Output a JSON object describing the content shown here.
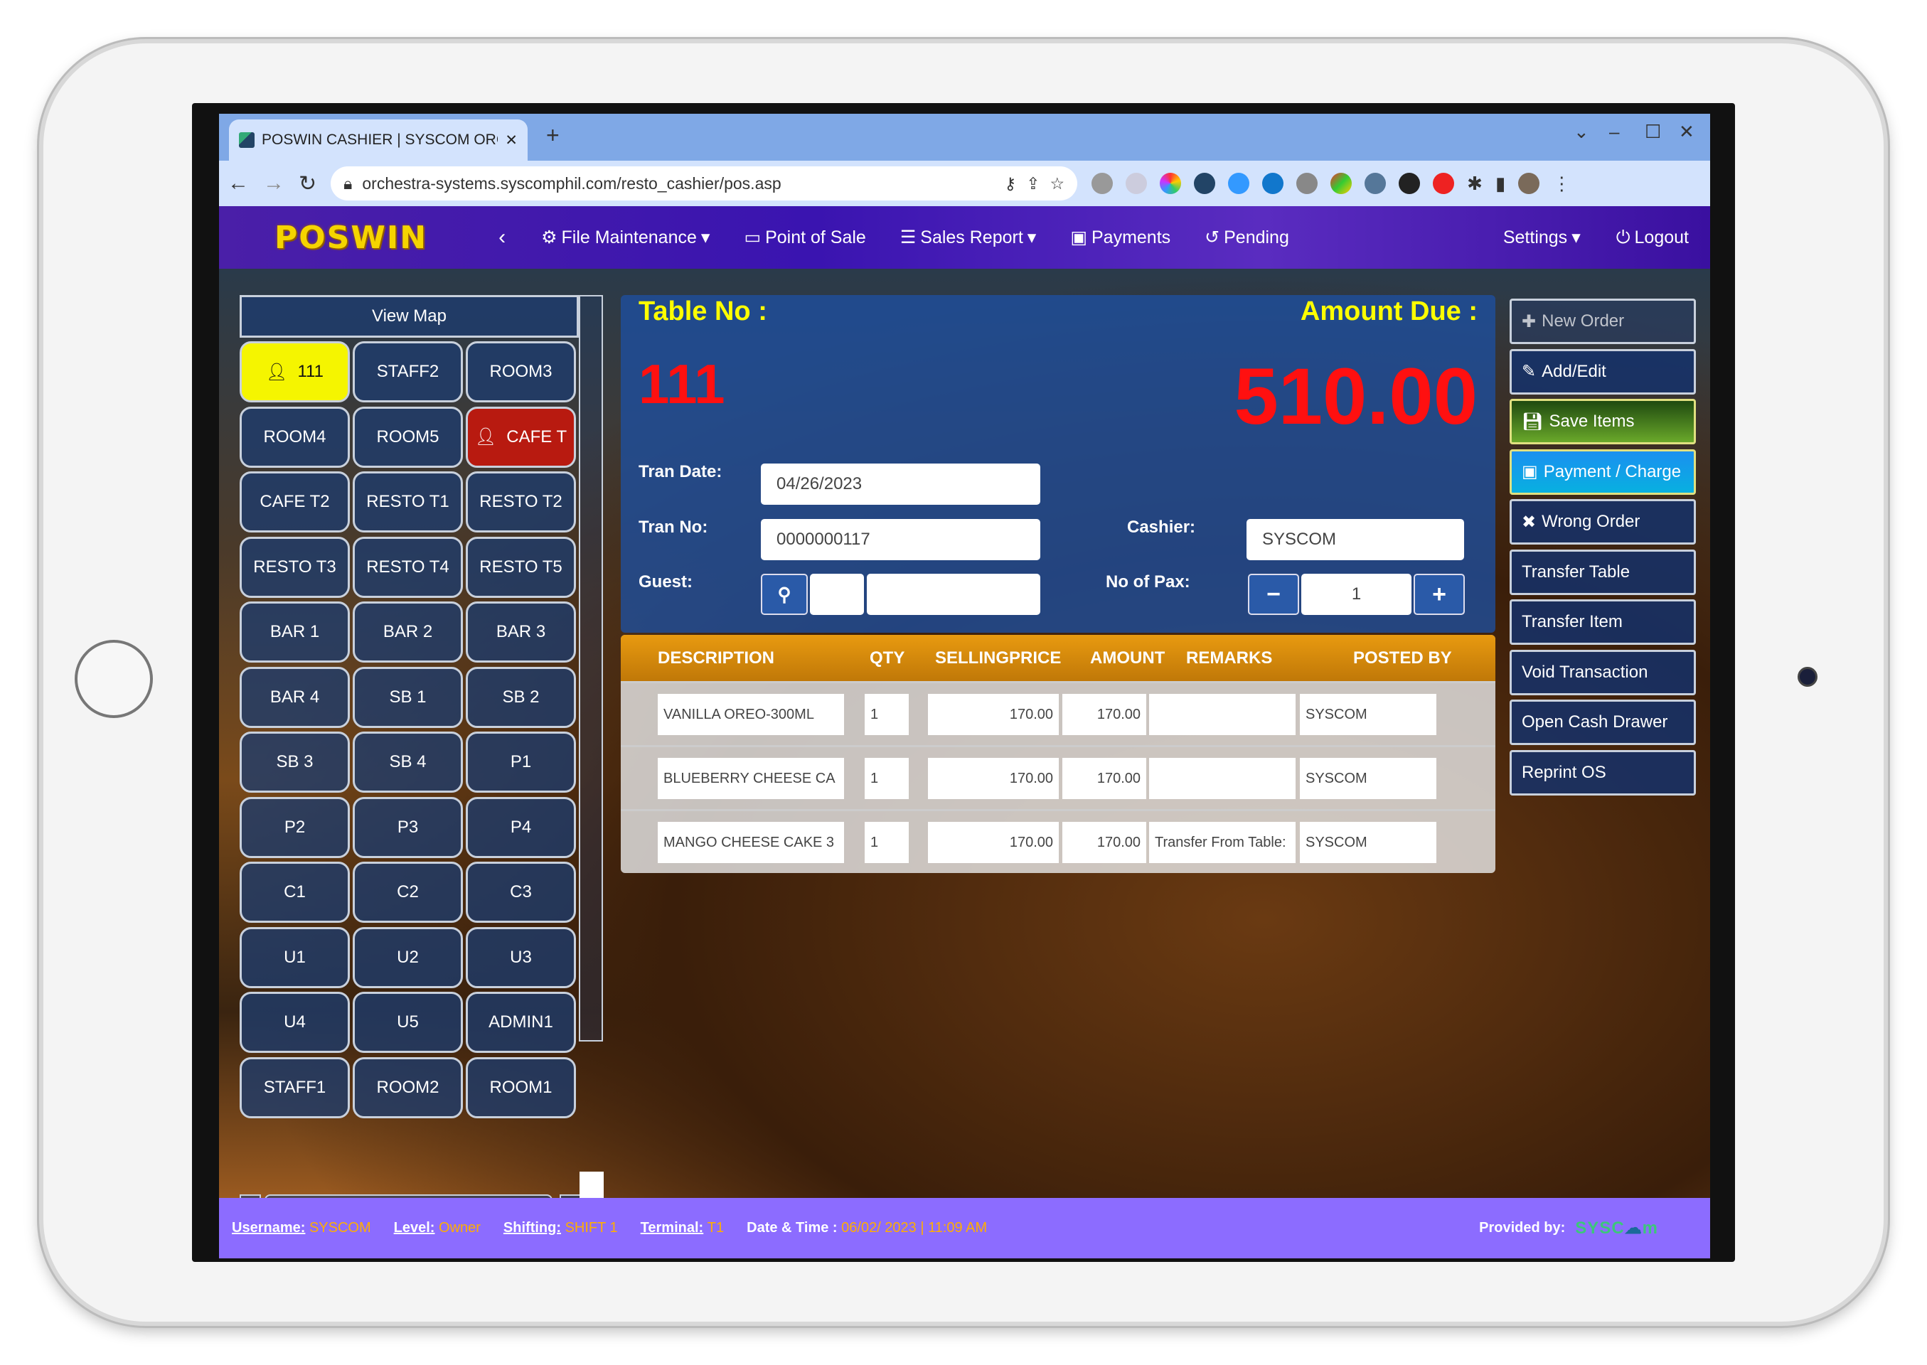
{
  "browser": {
    "tab_title": "POSWIN CASHIER | SYSCOM ORC",
    "url": "orchestra-systems.syscomphil.com/resto_cashier/pos.asp"
  },
  "nav": {
    "logo": "POSWIN",
    "items": [
      {
        "label": "File Maintenance",
        "icon": "gear-icon",
        "dropdown": true
      },
      {
        "label": "Point of Sale",
        "icon": "monitor-icon",
        "dropdown": false
      },
      {
        "label": "Sales Report",
        "icon": "list-icon",
        "dropdown": true
      },
      {
        "label": "Payments",
        "icon": "money-icon",
        "dropdown": false
      },
      {
        "label": "Pending",
        "icon": "history-icon",
        "dropdown": false
      }
    ],
    "settings": "Settings",
    "logout": "Logout"
  },
  "tables": {
    "view_map": "View Map",
    "items": [
      {
        "label": "111",
        "state": "selected"
      },
      {
        "label": "STAFF2"
      },
      {
        "label": "ROOM3"
      },
      {
        "label": "ROOM4"
      },
      {
        "label": "ROOM5"
      },
      {
        "label": "CAFE T",
        "state": "occupied"
      },
      {
        "label": "CAFE T2"
      },
      {
        "label": "RESTO T1"
      },
      {
        "label": "RESTO T2"
      },
      {
        "label": "RESTO T3"
      },
      {
        "label": "RESTO T4"
      },
      {
        "label": "RESTO T5"
      },
      {
        "label": "BAR 1"
      },
      {
        "label": "BAR 2"
      },
      {
        "label": "BAR 3"
      },
      {
        "label": "BAR 4"
      },
      {
        "label": "SB 1"
      },
      {
        "label": "SB 2"
      },
      {
        "label": "SB 3"
      },
      {
        "label": "SB 4"
      },
      {
        "label": "P1"
      },
      {
        "label": "P2"
      },
      {
        "label": "P3"
      },
      {
        "label": "P4"
      },
      {
        "label": "C1"
      },
      {
        "label": "C2"
      },
      {
        "label": "C3"
      },
      {
        "label": "U1"
      },
      {
        "label": "U2"
      },
      {
        "label": "U3"
      },
      {
        "label": "U4"
      },
      {
        "label": "U5"
      },
      {
        "label": "ADMIN1"
      },
      {
        "label": "STAFF1"
      },
      {
        "label": "ROOM2"
      },
      {
        "label": "ROOM1"
      }
    ]
  },
  "order": {
    "table_no_label": "Table No :",
    "table_no": "111",
    "amount_due_label": "Amount Due :",
    "amount_due": "510.00",
    "tran_date_label": "Tran Date:",
    "tran_date": "04/26/2023",
    "tran_no_label": "Tran No:",
    "tran_no": "0000000117",
    "cashier_label": "Cashier:",
    "cashier": "SYSCOM",
    "guest_label": "Guest:",
    "guest_code": "",
    "guest_name": "",
    "pax_label": "No of  Pax:",
    "pax": "1",
    "minus": "−",
    "plus": "+"
  },
  "items_table": {
    "columns": [
      "DESCRIPTION",
      "QTY",
      "SELLINGPRICE",
      "AMOUNT",
      "REMARKS",
      "POSTED BY"
    ],
    "rows": [
      {
        "description": "VANILLA OREO-300ML",
        "qty": "1",
        "price": "170.00",
        "amount": "170.00",
        "remarks": "",
        "posted_by": "SYSCOM"
      },
      {
        "description": "BLUEBERRY CHEESE CA",
        "qty": "1",
        "price": "170.00",
        "amount": "170.00",
        "remarks": "",
        "posted_by": "SYSCOM"
      },
      {
        "description": "MANGO CHEESE CAKE 3",
        "qty": "1",
        "price": "170.00",
        "amount": "170.00",
        "remarks": "Transfer From Table:",
        "posted_by": "SYSCOM"
      }
    ]
  },
  "actions": [
    {
      "label": "New Order",
      "icon": "plus-icon",
      "style": "disabled"
    },
    {
      "label": "Add/Edit",
      "icon": "pencil-icon"
    },
    {
      "label": "Save Items",
      "icon": "save-icon",
      "style": "success"
    },
    {
      "label": "Payment / Charge",
      "icon": "money-icon",
      "style": "info"
    },
    {
      "label": "Wrong Order",
      "icon": "x-icon"
    },
    {
      "label": "Transfer Table"
    },
    {
      "label": "Transfer Item"
    },
    {
      "label": "Void Transaction"
    },
    {
      "label": "Open Cash Drawer"
    },
    {
      "label": "Reprint OS"
    }
  ],
  "status": {
    "username_label": "Username:",
    "username": "SYSCOM",
    "level_label": "Level:",
    "level": "Owner",
    "shifting_label": "Shifting:",
    "shifting": "SHIFT 1",
    "terminal_label": "Terminal:",
    "terminal": "T1",
    "datetime_label": "Date & Time :",
    "datetime": "06/02/ 2023 | 11:09 AM",
    "provided_label": "Provided by:",
    "provider_logo": "SYSCOM"
  },
  "colors": {
    "nav": "#3a14b0",
    "status_bar": "#8c6cff",
    "accent_yellow": "#ffff00",
    "amount_red": "#ff1010",
    "header_orange": "#e89a10",
    "save_green": "#5a9a20",
    "payment_blue": "#1aa0f0"
  }
}
